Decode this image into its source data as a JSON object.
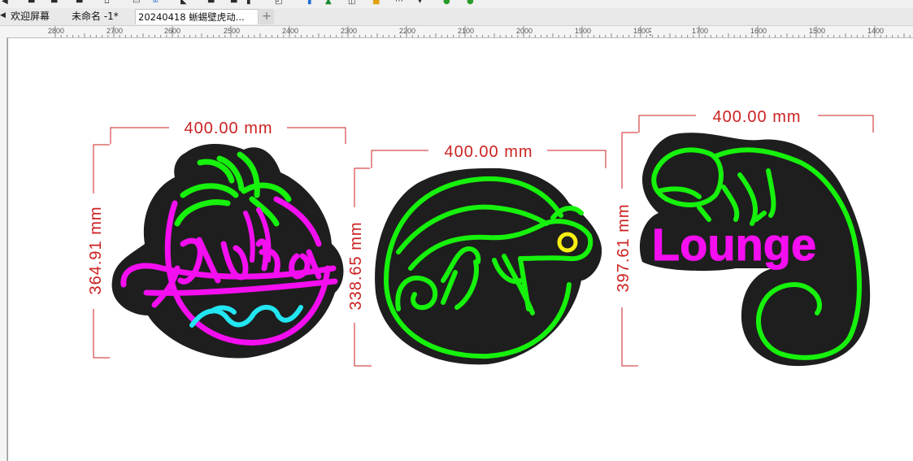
{
  "tabs": [
    {
      "label": "欢迎屏幕",
      "active": false
    },
    {
      "label": "未命名 -1*",
      "active": false
    },
    {
      "label": "20240418 蜥蜴壁虎动...",
      "active": true
    }
  ],
  "new_tab_symbol": "+",
  "ruler": {
    "labels": [
      "2800",
      "2700",
      "2600",
      "2500",
      "2400",
      "2300",
      "2200",
      "2100",
      "2000",
      "1900",
      "1800",
      "1700",
      "1600",
      "1500",
      "1400"
    ]
  },
  "designs": [
    {
      "name": "Aloha",
      "width_label": "400.00 mm",
      "height_label": "364.91 mm"
    },
    {
      "name": "chameleon",
      "width_label": "400.00 mm",
      "height_label": "338.65 mm"
    },
    {
      "name": "Lounge chameleon",
      "width_label": "400.00 mm",
      "height_label": "397.61 mm"
    }
  ],
  "sign_text": {
    "aloha": "Aloha",
    "lounge": "Lounge"
  },
  "colors": {
    "board": "#1e1e1e",
    "neon_green": "#16f20c",
    "neon_magenta": "#f40ef0",
    "neon_cyan": "#22e6f2",
    "neon_yellow": "#f7ef12",
    "dimension": "#cc2222"
  },
  "toolbar_icons": [
    "back-icon",
    "tool-icon",
    "tool-icon",
    "tool-icon",
    "cube-icon",
    "link-icon",
    "tool-icon",
    "align-icon",
    "tool-icon",
    "crop-icon",
    "pen-icon",
    "fill-icon",
    "folder-icon",
    "grid-icon",
    "globe-icon",
    "recycle-icon"
  ]
}
